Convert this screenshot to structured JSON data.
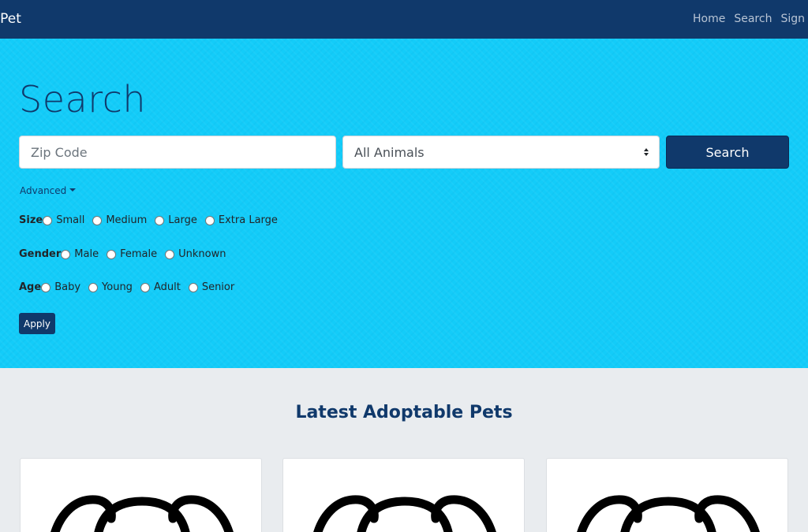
{
  "navbar": {
    "brand": "-Pet",
    "links": [
      "Home",
      "Search",
      "Sign"
    ]
  },
  "hero": {
    "title": "Search",
    "zip_placeholder": "Zip Code",
    "animal_select_value": "All Animals",
    "search_button": "Search",
    "advanced_label": "Advanced",
    "filters": {
      "size": {
        "label": "Size",
        "options": [
          "Small",
          "Medium",
          "Large",
          "Extra Large"
        ]
      },
      "gender": {
        "label": "Gender",
        "options": [
          "Male",
          "Female",
          "Unknown"
        ]
      },
      "age": {
        "label": "Age",
        "options": [
          "Baby",
          "Young",
          "Adult",
          "Senior"
        ]
      }
    },
    "apply_button": "Apply"
  },
  "latest": {
    "title": "Latest Adoptable Pets"
  },
  "colors": {
    "navbar": "#10396b",
    "hero_bg": "#13ccf9",
    "page_bg": "#e9ecef",
    "primary": "#10396b"
  },
  "icons": {
    "pet_card_image": "dog-face-outline-icon",
    "select_arrows": "up-down-arrows-icon",
    "advanced_caret": "caret-down-icon"
  }
}
